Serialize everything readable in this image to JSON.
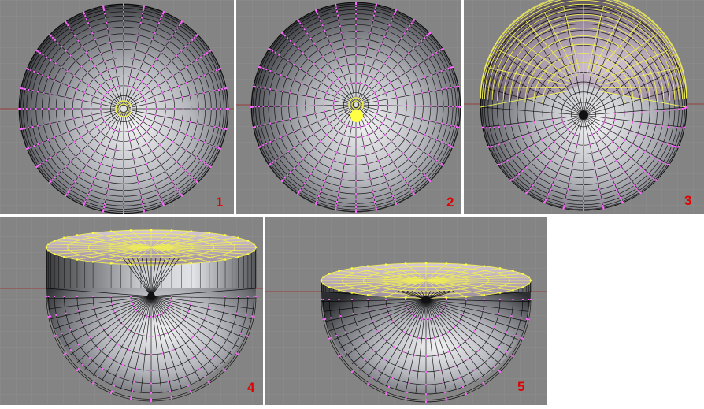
{
  "panels": [
    {
      "label": "1"
    },
    {
      "label": "2"
    },
    {
      "label": "3"
    },
    {
      "label": "4"
    },
    {
      "label": "5"
    }
  ],
  "colors": {
    "viewport_bg": "#848484",
    "grid_line": "#8e8e8e",
    "axis_line": "#9a3b3b",
    "vertex": "#ff66ff",
    "selected_vertex": "#ffff44",
    "selected_edge": "#f0ee55",
    "wire": "#000000",
    "label": "#e00000",
    "separator": "#ffffff"
  },
  "icons": [
    "uv-sphere-mesh",
    "vertex-dot",
    "selected-vertex-dot"
  ]
}
